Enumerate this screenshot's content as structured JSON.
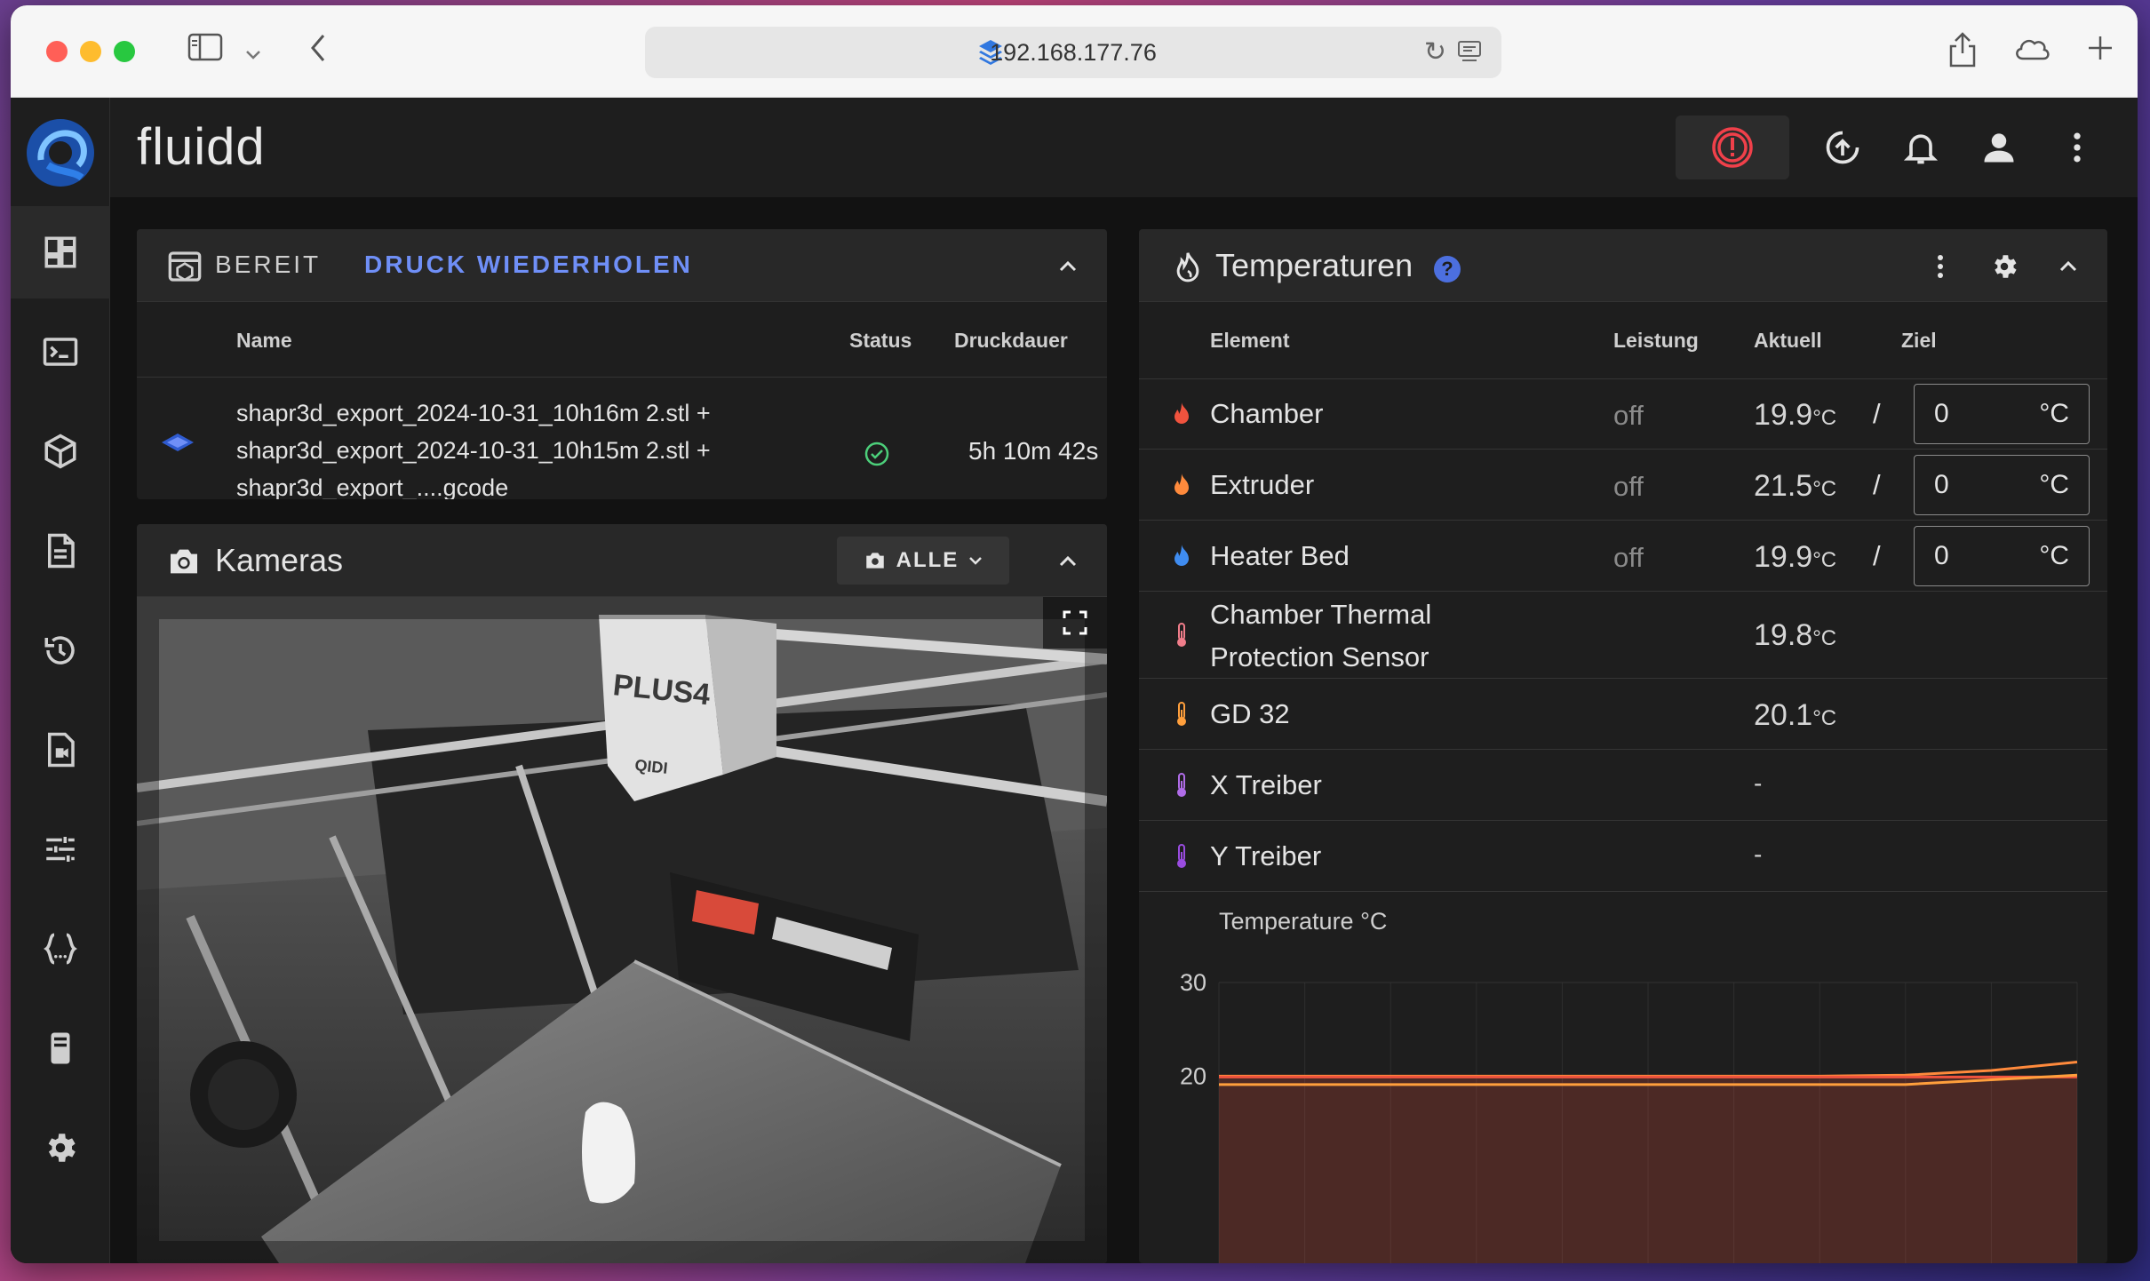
{
  "browser": {
    "url": "192.168.177.76"
  },
  "app": {
    "title": "fluidd"
  },
  "sidebar": {
    "items": [
      {
        "icon": "dashboard-icon",
        "active": true
      },
      {
        "icon": "console-icon"
      },
      {
        "icon": "cube-icon"
      },
      {
        "icon": "files-icon"
      },
      {
        "icon": "history-icon"
      },
      {
        "icon": "timelapse-icon"
      },
      {
        "icon": "tune-icon"
      },
      {
        "icon": "code-icon"
      },
      {
        "icon": "device-icon"
      },
      {
        "icon": "settings-icon"
      }
    ]
  },
  "status_card": {
    "state": "BEREIT",
    "reprint_label": "DRUCK WIEDERHOLEN",
    "columns": {
      "name": "Name",
      "status": "Status",
      "duration": "Druckdauer"
    },
    "job": {
      "name_lines": [
        "shapr3d_export_2024-10-31_10h16m 2.stl +",
        "shapr3d_export_2024-10-31_10h15m 2.stl +",
        "shapr3d_export_....gcode"
      ],
      "status": "completed",
      "duration": "5h 10m 42s"
    }
  },
  "camera_card": {
    "title": "Kameras",
    "select_label": "ALLE",
    "printer_label_top": "PLUS4",
    "printer_label_bottom": "QIDI"
  },
  "temperature_card": {
    "title": "Temperaturen",
    "help": "?",
    "columns": {
      "element": "Element",
      "power": "Leistung",
      "current": "Aktuell",
      "target": "Ziel"
    },
    "unit": "°C",
    "unit_small": "°C",
    "rows": [
      {
        "name": "Chamber",
        "power": "off",
        "current": "19.9",
        "target": "0",
        "color": "#f0533e",
        "type": "heater"
      },
      {
        "name": "Extruder",
        "power": "off",
        "current": "21.5",
        "target": "0",
        "color": "#ff8a3c",
        "type": "heater"
      },
      {
        "name": "Heater Bed",
        "power": "off",
        "current": "19.9",
        "target": "0",
        "color": "#3f8cf0",
        "type": "heater"
      },
      {
        "name": "Chamber Thermal",
        "name2": "Protection Sensor",
        "current": "19.8",
        "color": "#f07d8a",
        "type": "sensor"
      },
      {
        "name": "GD 32",
        "current": "20.1",
        "color": "#ff9f3c",
        "type": "sensor"
      },
      {
        "name": "X Treiber",
        "current": "-",
        "color": "#b06ce8",
        "type": "sensor"
      },
      {
        "name": "Y Treiber",
        "current": "-",
        "color": "#9a4ce0",
        "type": "sensor"
      }
    ],
    "slash": "/"
  },
  "chart_data": {
    "type": "line",
    "title": "",
    "ylabel": "Temperature °C",
    "ylim": [
      0,
      30
    ],
    "yticks": [
      "30",
      "20"
    ],
    "series": [
      {
        "values": [
          20.0,
          20.0,
          20.0,
          20.0,
          20.0,
          20.0,
          20.0,
          20.0,
          20.1,
          20.6,
          21.5
        ],
        "color": "#ff8a3c"
      },
      {
        "values": [
          19.9,
          19.9,
          19.9,
          19.9,
          19.9,
          19.9,
          19.9,
          19.9,
          19.9,
          19.9,
          19.9
        ],
        "color": "#f0533e"
      },
      {
        "values": [
          19.1,
          19.1,
          19.1,
          19.1,
          19.1,
          19.1,
          19.1,
          19.1,
          19.1,
          19.6,
          20.1
        ],
        "color": "#ff9f3c"
      }
    ]
  }
}
